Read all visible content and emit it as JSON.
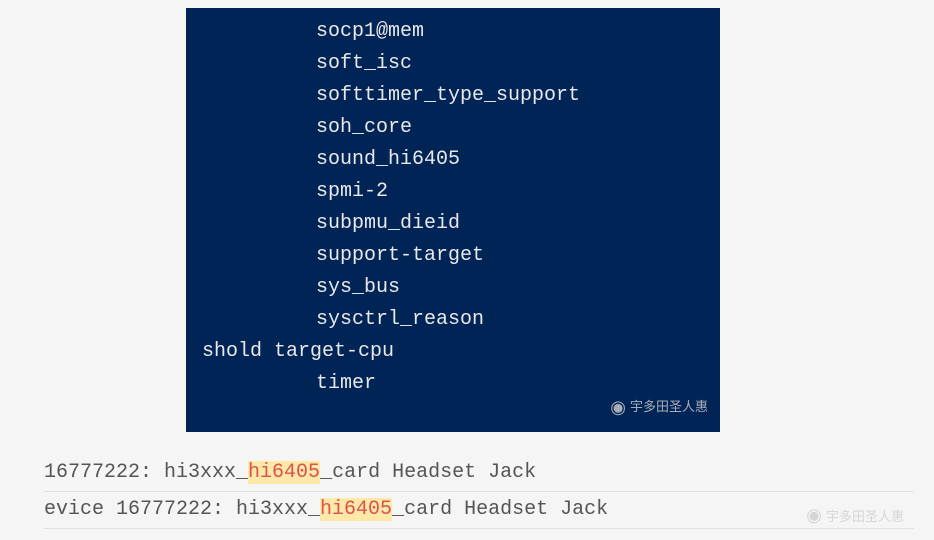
{
  "terminal": {
    "lines": [
      {
        "text": "socp1@mem",
        "indented": true
      },
      {
        "text": "soft_isc",
        "indented": true
      },
      {
        "text": "softtimer_type_support",
        "indented": true
      },
      {
        "text": "soh_core",
        "indented": true
      },
      {
        "text": "sound_hi6405",
        "indented": true
      },
      {
        "text": "spmi-2",
        "indented": true
      },
      {
        "text": "subpmu_dieid",
        "indented": true
      },
      {
        "text": "support-target",
        "indented": true
      },
      {
        "text": "sys_bus",
        "indented": true
      },
      {
        "text": "sysctrl_reason",
        "indented": true
      },
      {
        "text": "shold target-cpu",
        "indented": false
      },
      {
        "text": "timer",
        "indented": true
      }
    ],
    "watermark": {
      "icon": "◉",
      "text": "宇多田圣人惠"
    }
  },
  "log": {
    "lines": [
      {
        "prefix": " 16777222: hi3xxx_",
        "highlight": "hi6405",
        "suffix": "_card Headset Jack"
      },
      {
        "prefix": "evice 16777222: hi3xxx_",
        "highlight": "hi6405",
        "suffix": "_card Headset Jack"
      }
    ]
  },
  "bottom_watermark": {
    "icon": "◉",
    "text": "宇多田圣人惠"
  }
}
